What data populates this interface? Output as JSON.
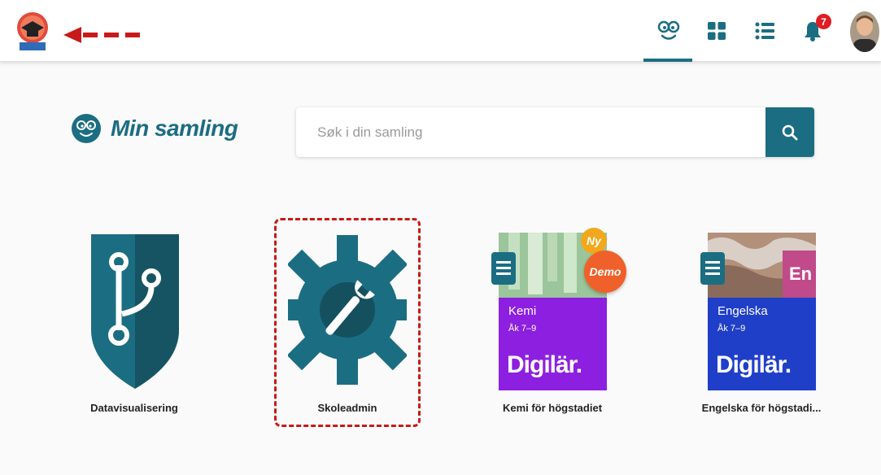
{
  "header": {
    "logo_name": "school-badge-logo",
    "nav": [
      {
        "name": "collection-icon",
        "active": true
      },
      {
        "name": "grid-icon",
        "active": false
      },
      {
        "name": "list-icon",
        "active": false
      },
      {
        "name": "bell-icon",
        "active": false
      }
    ],
    "notification_count": "7"
  },
  "main": {
    "title": "Min samling",
    "search": {
      "placeholder": "Søk i din samling",
      "value": ""
    }
  },
  "tiles": [
    {
      "label": "Datavisualisering",
      "icon": "shield-branch-icon"
    },
    {
      "label": "Skoleadmin",
      "icon": "gear-wrench-icon"
    },
    {
      "label": "Kemi för högstadiet",
      "subject": "Kemi",
      "grade": "Åk 7–9",
      "brand": "Digilär.",
      "badge_ny": "Ny",
      "badge_demo": "Demo"
    },
    {
      "label": "Engelska för högstadi...",
      "subject": "Engelska",
      "grade": "Åk 7–9",
      "brand": "Digilär.",
      "badge_lang": "En"
    }
  ],
  "colors": {
    "accent": "#1b6d82",
    "badge_red": "#e11b22",
    "annotation_red": "#c81a1a",
    "kemi_purple": "#8d1fe0",
    "engelska_blue": "#1f3fc9",
    "demo_orange": "#f0602a",
    "ny_yellow": "#f2a81d"
  }
}
